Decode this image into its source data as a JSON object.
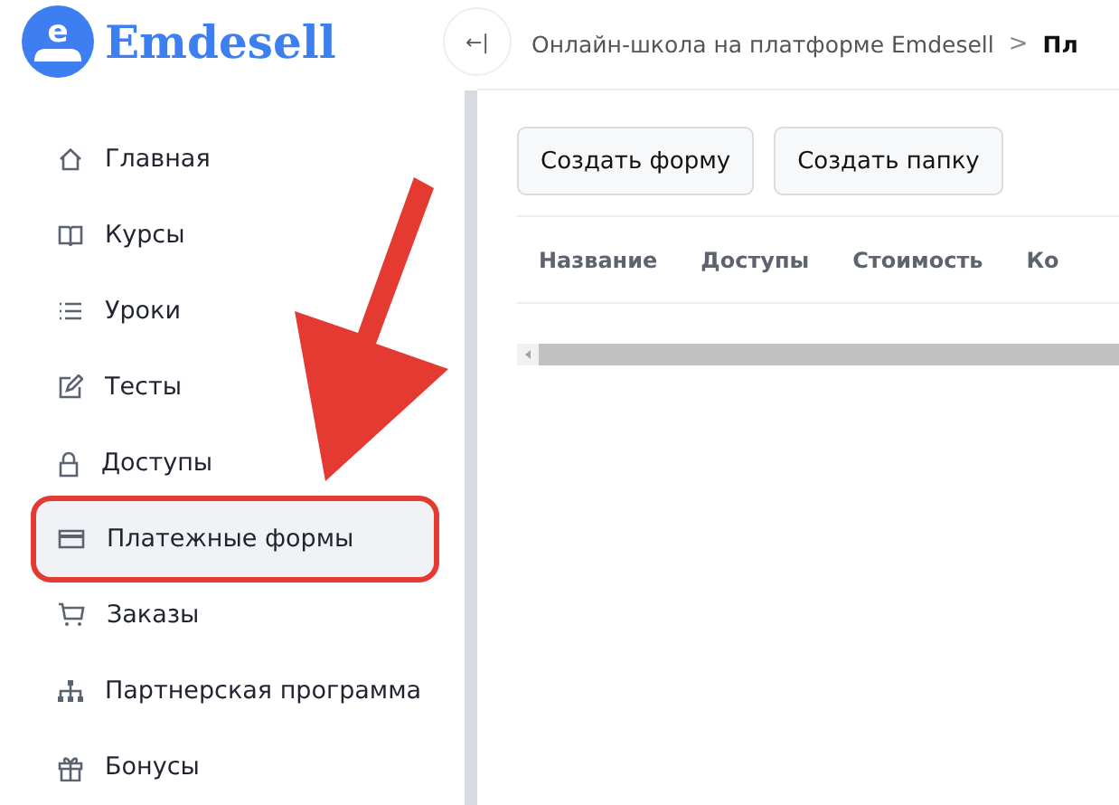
{
  "logo": {
    "text": "Emdesell",
    "glyph": "e"
  },
  "collapse_button": {
    "glyph": "←|"
  },
  "breadcrumbs": [
    {
      "label": "Онлайн-школа на платформе Emdesell",
      "current": false
    },
    {
      "label": "Пл",
      "current": true
    }
  ],
  "breadcrumb_separator": ">",
  "sidebar": {
    "items": [
      {
        "label": "Главная",
        "kind": "home",
        "selected": false,
        "highlighted": false
      },
      {
        "label": "Курсы",
        "kind": "book",
        "selected": false,
        "highlighted": false
      },
      {
        "label": "Уроки",
        "kind": "list",
        "selected": false,
        "highlighted": false
      },
      {
        "label": "Тесты",
        "kind": "edit",
        "selected": false,
        "highlighted": false
      },
      {
        "label": "Доступы",
        "kind": "lock",
        "selected": false,
        "highlighted": false
      },
      {
        "label": "Платежные формы",
        "kind": "card",
        "selected": true,
        "highlighted": true
      },
      {
        "label": "Заказы",
        "kind": "cart",
        "selected": false,
        "highlighted": false
      },
      {
        "label": "Партнерская программа",
        "kind": "tree",
        "selected": false,
        "highlighted": false
      },
      {
        "label": "Бонусы",
        "kind": "gift",
        "selected": false,
        "highlighted": false
      }
    ]
  },
  "buttons": [
    "Создать форму",
    "Создать папку"
  ],
  "table": {
    "columns": [
      "Название",
      "Доступы",
      "Стоимость",
      "Ко"
    ]
  },
  "annotation_arrow": {
    "color": "#e53a31"
  }
}
